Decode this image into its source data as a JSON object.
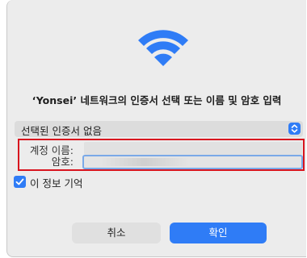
{
  "dialog": {
    "title": "‘Yonsei’ 네트워크의 인증서 선택 또는 이름 및 암호 입력",
    "icon": "wifi-icon",
    "accent_color": "#2F7CF6",
    "highlight_color": "#D8141E"
  },
  "certificate": {
    "selected": "선택된 인증서 없음",
    "chevron_icon": "chevron-updown-icon"
  },
  "form": {
    "account_label": "계정 이름:",
    "account_value": "",
    "password_label": "암호:",
    "password_value": ""
  },
  "remember": {
    "label": "이 정보 기억",
    "checked": true
  },
  "buttons": {
    "cancel": "취소",
    "ok": "확인"
  }
}
